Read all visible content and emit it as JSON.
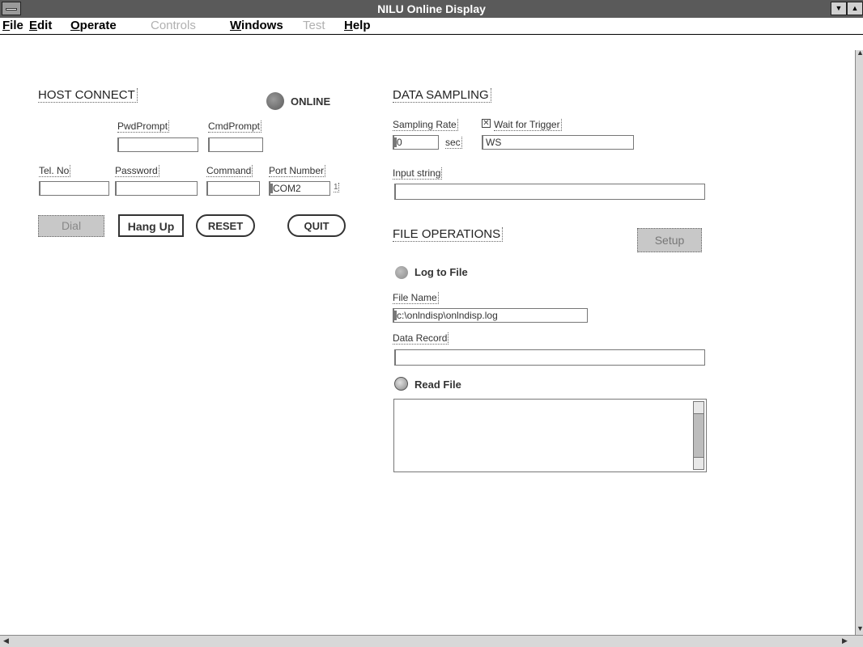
{
  "window": {
    "title": "NILU Online Display"
  },
  "menu": {
    "file": "File",
    "edit": "Edit",
    "operate": "Operate",
    "controls": "Controls",
    "windows": "Windows",
    "test": "Test",
    "help": "Help"
  },
  "host_connect": {
    "title": "HOST CONNECT",
    "online_label": "ONLINE",
    "pwd_prompt_label": "PwdPrompt",
    "cmd_prompt_label": "CmdPrompt",
    "tel_no_label": "Tel. No",
    "password_label": "Password",
    "command_label": "Command",
    "port_number_label": "Port Number",
    "port_value": "COM2",
    "port_suffix": "1",
    "dial_label": "Dial",
    "hang_up_label": "Hang Up",
    "reset_label": "RESET",
    "quit_label": "QUIT"
  },
  "data_sampling": {
    "title": "DATA SAMPLING",
    "sampling_rate_label": "Sampling Rate",
    "sampling_rate_value": "0",
    "sec_label": "sec",
    "wait_for_trigger_label": "Wait for Trigger",
    "wait_for_trigger_checked": true,
    "trigger_value": "WS",
    "input_string_label": "Input string",
    "input_string_value": ""
  },
  "file_operations": {
    "title": "FILE OPERATIONS",
    "setup_label": "Setup",
    "log_to_file_label": "Log to File",
    "file_name_label": "File Name",
    "file_name_value": "c:\\onlndisp\\onlndisp.log",
    "data_record_label": "Data Record",
    "data_record_value": "",
    "read_file_label": "Read File"
  },
  "colors": {
    "titlebar": "#5a5a5a",
    "led_online": "#6e6e6e",
    "button_disabled": "#c8c8c8"
  }
}
